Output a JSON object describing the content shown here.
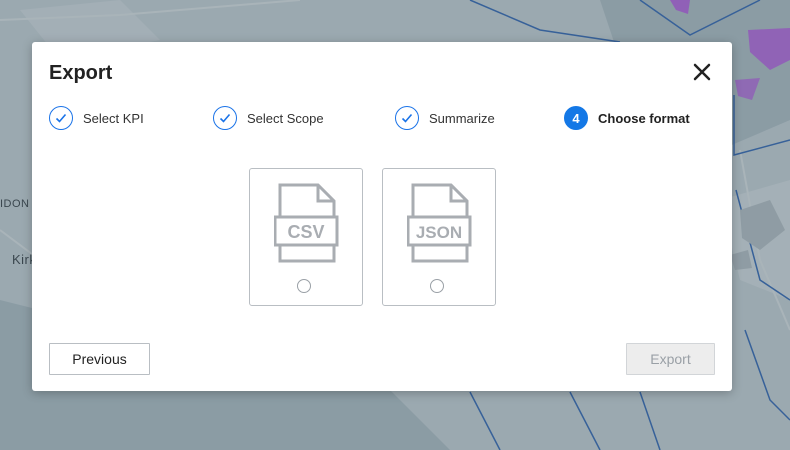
{
  "map": {
    "labels": [
      "IDON",
      "Kirk"
    ]
  },
  "dialog": {
    "title": "Export",
    "close_icon": "close-icon",
    "steps": [
      {
        "label": "Select KPI",
        "state": "done"
      },
      {
        "label": "Select Scope",
        "state": "done"
      },
      {
        "label": "Summarize",
        "state": "done"
      },
      {
        "label": "Choose format",
        "state": "active",
        "number": "4"
      }
    ],
    "formats": [
      {
        "label": "CSV",
        "selected": false
      },
      {
        "label": "JSON",
        "selected": false
      }
    ],
    "previous_label": "Previous",
    "export_label": "Export"
  },
  "colors": {
    "accent": "#1478e6",
    "map_route": "#2a5fa8",
    "map_heat": "#a64fd6"
  }
}
